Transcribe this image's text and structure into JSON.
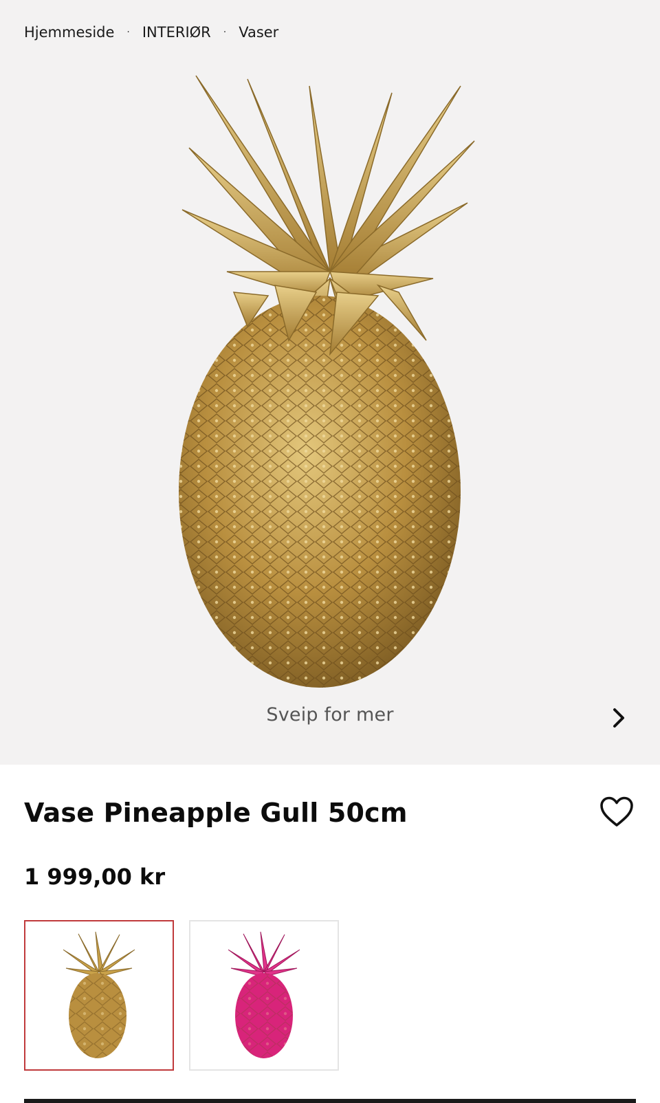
{
  "breadcrumb": {
    "items": [
      {
        "label": "Hjemmeside"
      },
      {
        "label": "INTERIØR"
      },
      {
        "label": "Vaser"
      }
    ],
    "separator": "·"
  },
  "gallery": {
    "swipe_hint": "Sveip for mer",
    "next_icon": "chevron-right-icon",
    "background": "#f3f2f2"
  },
  "product": {
    "title": "Vase Pineapple Gull 50cm",
    "price": "1 999,00 kr",
    "favorite_icon": "heart-outline-icon"
  },
  "variants": [
    {
      "name": "gold",
      "color": "#c9a24a",
      "selected": true
    },
    {
      "name": "pink",
      "color": "#d8247a",
      "selected": false
    }
  ],
  "colors": {
    "selected_border": "#c0393b",
    "gold": "#c9a24a",
    "pink": "#d8247a"
  }
}
